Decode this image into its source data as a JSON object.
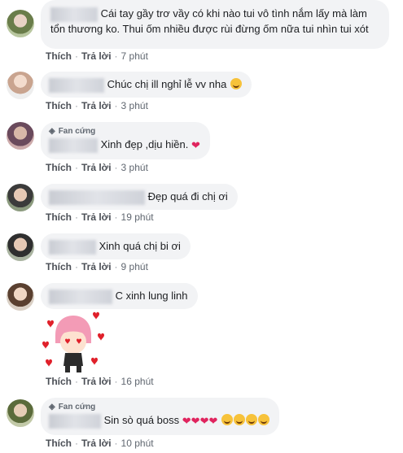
{
  "actions": {
    "like": "Thích",
    "reply": "Trả lời"
  },
  "badge_fan": "Fan cứng",
  "comments": [
    {
      "text_line1": "Cái tay gầy trơ vầy có khi nào tui vô tình nắm lấy mà làm",
      "text_line2": "tổn thương ko. Thui ốm nhiều được rùi đừng ốm nữa tui nhìn tui xót",
      "time": "7 phút"
    },
    {
      "text": "Chúc chị ill nghỉ lễ vv nha",
      "emoji": "kiss-face",
      "time": "3 phút"
    },
    {
      "text": "Xinh đẹp ,dịu hiền.",
      "emoji": "red-heart",
      "time": "3 phút"
    },
    {
      "text": "Đẹp quá đi chị ơi",
      "time": "19 phút"
    },
    {
      "text": "Xinh quá chị bi ơi",
      "time": "9 phút"
    },
    {
      "text": "C xinh lung linh",
      "sticker": "pink-hair-girl-hearts-sticker",
      "time": "16 phút"
    },
    {
      "text": "Sin sò quá boss",
      "emoji": "hearts-and-smiling-faces",
      "time": "10 phút"
    }
  ]
}
